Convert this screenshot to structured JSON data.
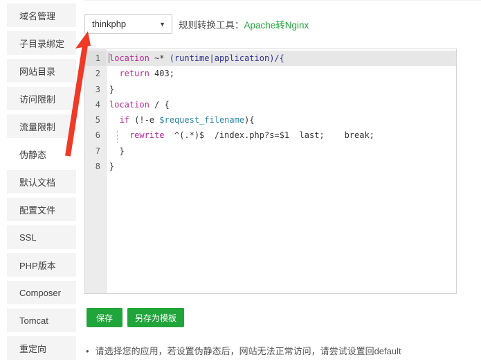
{
  "sidebar": {
    "items": [
      {
        "name": "domain-manage",
        "label": "域名管理",
        "active": false
      },
      {
        "name": "subdir-bind",
        "label": "子目录绑定",
        "active": false
      },
      {
        "name": "site-directory",
        "label": "网站目录",
        "active": false
      },
      {
        "name": "access-limit",
        "label": "访问限制",
        "active": false
      },
      {
        "name": "traffic-limit",
        "label": "流量限制",
        "active": false
      },
      {
        "name": "url-rewrite",
        "label": "伪静态",
        "active": true
      },
      {
        "name": "default-doc",
        "label": "默认文档",
        "active": false
      },
      {
        "name": "config-file",
        "label": "配置文件",
        "active": false
      },
      {
        "name": "ssl",
        "label": "SSL",
        "active": false
      },
      {
        "name": "php-version",
        "label": "PHP版本",
        "active": false
      },
      {
        "name": "composer",
        "label": "Composer",
        "active": false
      },
      {
        "name": "tomcat",
        "label": "Tomcat",
        "active": false
      },
      {
        "name": "redirect",
        "label": "重定向",
        "active": false
      }
    ]
  },
  "toolbar": {
    "app_select": {
      "value": "thinkphp",
      "caret": "▼"
    },
    "convert_label": "规则转换工具：",
    "convert_link": "Apache转Nginx"
  },
  "editor": {
    "lines": [
      {
        "no": "1",
        "active": true,
        "tokens": [
          [
            "kw",
            "location"
          ],
          [
            "pl",
            " ~* "
          ],
          [
            "str",
            "(runtime|application)/{"
          ]
        ]
      },
      {
        "no": "2",
        "active": false,
        "tokens": [
          [
            "pl",
            "  "
          ],
          [
            "kw",
            "return"
          ],
          [
            "pl",
            " 403;"
          ]
        ]
      },
      {
        "no": "3",
        "active": false,
        "tokens": [
          [
            "pl",
            "}"
          ]
        ]
      },
      {
        "no": "4",
        "active": false,
        "tokens": [
          [
            "kw",
            "location"
          ],
          [
            "pl",
            " / {"
          ]
        ]
      },
      {
        "no": "5",
        "active": false,
        "tokens": [
          [
            "pl",
            "  "
          ],
          [
            "kw",
            "if"
          ],
          [
            "pl",
            " (!-e "
          ],
          [
            "var",
            "$request_filename"
          ],
          [
            "pl",
            "){"
          ]
        ]
      },
      {
        "no": "6",
        "active": false,
        "tokens": [
          [
            "pl",
            "    "
          ],
          [
            "kw",
            "rewrite"
          ],
          [
            "pl",
            "  ^(.*)$  /index.php?s=$1  last;    break;"
          ]
        ]
      },
      {
        "no": "7",
        "active": false,
        "tokens": [
          [
            "pl",
            "  }"
          ]
        ]
      },
      {
        "no": "8",
        "active": false,
        "tokens": [
          [
            "pl",
            "}"
          ]
        ]
      }
    ]
  },
  "buttons": {
    "save": "保存",
    "save_as_template": "另存为模板"
  },
  "note": {
    "bullet": "•",
    "text": "请选择您的应用，若设置伪静态后，网站无法正常访问，请尝试设置回default"
  },
  "colors": {
    "green": "#20a53a",
    "arrow_red": "#ee3a26",
    "keyword": "#b52a96",
    "string_blue": "#2d3095",
    "variable_teal": "#2e86a0"
  }
}
